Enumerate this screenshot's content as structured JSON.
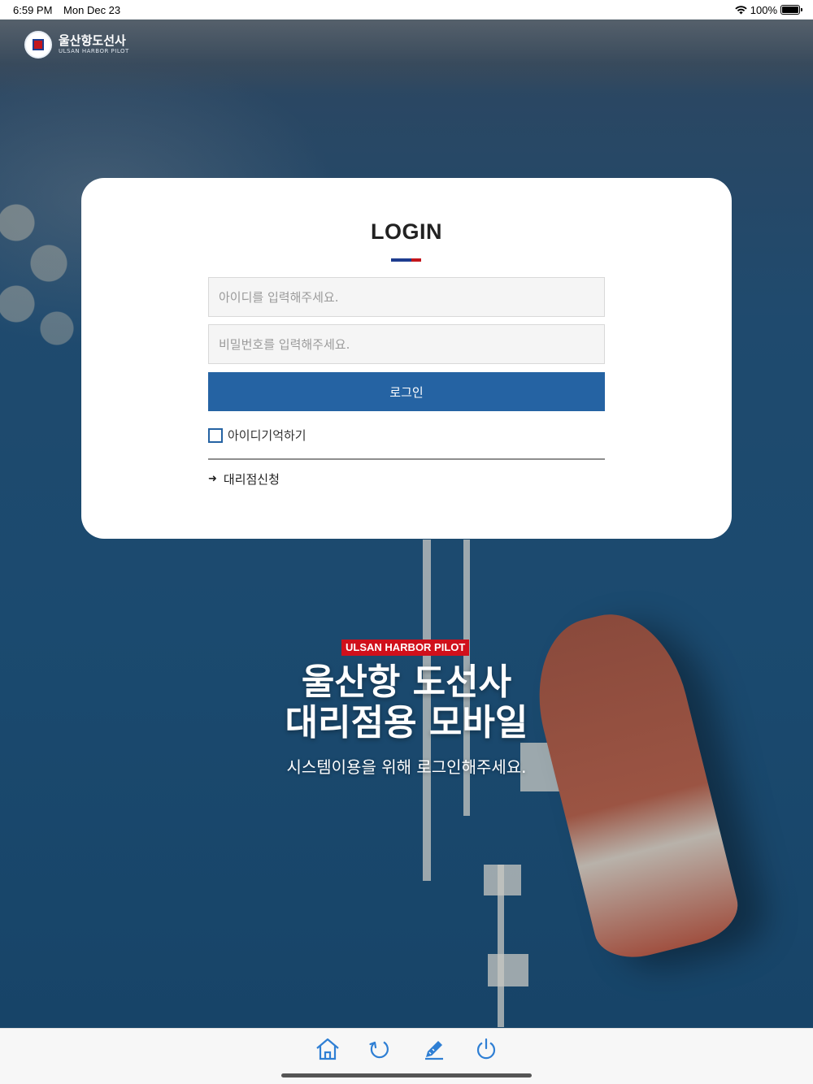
{
  "status_bar": {
    "time": "6:59 PM",
    "date": "Mon Dec 23",
    "battery": "100%",
    "wifi_icon": "wifi-icon",
    "battery_icon": "battery-icon"
  },
  "brand": {
    "name_ko": "울산항도선사",
    "name_en": "ULSAN HARBOR PILOT"
  },
  "login": {
    "title": "LOGIN",
    "id_placeholder": "아이디를 입력해주세요.",
    "password_placeholder": "비밀번호를 입력해주세요.",
    "submit_label": "로그인",
    "remember_label": "아이디기억하기",
    "remember_checked": false,
    "agency_link": "대리점신청"
  },
  "hero": {
    "badge": "ULSAN HARBOR PILOT",
    "title_line1": "울산항 도선사",
    "title_line2": "대리점용 모바일",
    "subtitle": "시스템이용을 위해 로그인해주세요."
  },
  "toolbar": {
    "buttons": [
      "home-icon",
      "refresh-icon",
      "edit-icon",
      "power-icon"
    ]
  },
  "colors": {
    "primary": "#2563a3",
    "badge_red": "#d0101b",
    "title_bar": [
      "#1e3d8f",
      "#1e3d8f",
      "#c4161c"
    ],
    "toolbar_icon": "#2f7fd4"
  }
}
